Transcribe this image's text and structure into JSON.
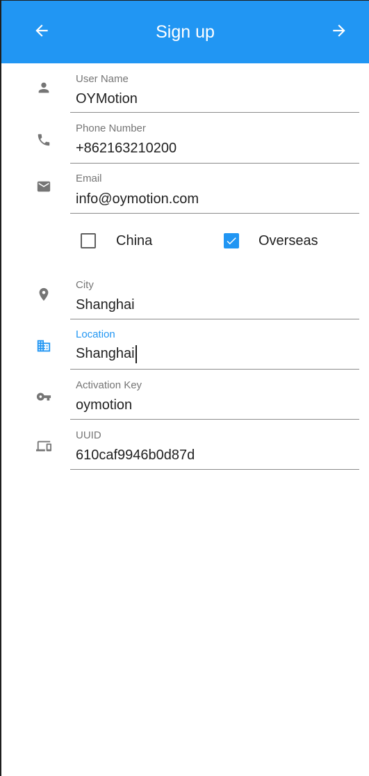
{
  "appbar": {
    "title": "Sign up",
    "back_icon": "arrow-left-icon",
    "forward_icon": "arrow-right-icon",
    "background_color": "#2196F3"
  },
  "fields": {
    "username": {
      "label": "User Name",
      "value": "OYMotion",
      "icon": "person-icon"
    },
    "phone": {
      "label": "Phone Number",
      "value": "+862163210200",
      "icon": "phone-icon"
    },
    "email": {
      "label": "Email",
      "value": "info@oymotion.com",
      "icon": "mail-icon"
    },
    "city": {
      "label": "City",
      "value": "Shanghai",
      "icon": "location-pin-icon"
    },
    "location": {
      "label": "Location",
      "value": "Shanghai",
      "icon": "business-icon",
      "focused": true
    },
    "activation_key": {
      "label": "Activation Key",
      "value": "oymotion",
      "icon": "key-icon"
    },
    "uuid": {
      "label": "UUID",
      "value": "610caf9946b0d87d",
      "icon": "devices-icon"
    }
  },
  "region": {
    "china": {
      "label": "China",
      "checked": false
    },
    "overseas": {
      "label": "Overseas",
      "checked": true
    }
  },
  "colors": {
    "accent": "#2196F3",
    "icon_grey": "#757575",
    "text": "#1f1f1f",
    "divider": "#8a8a8a"
  }
}
